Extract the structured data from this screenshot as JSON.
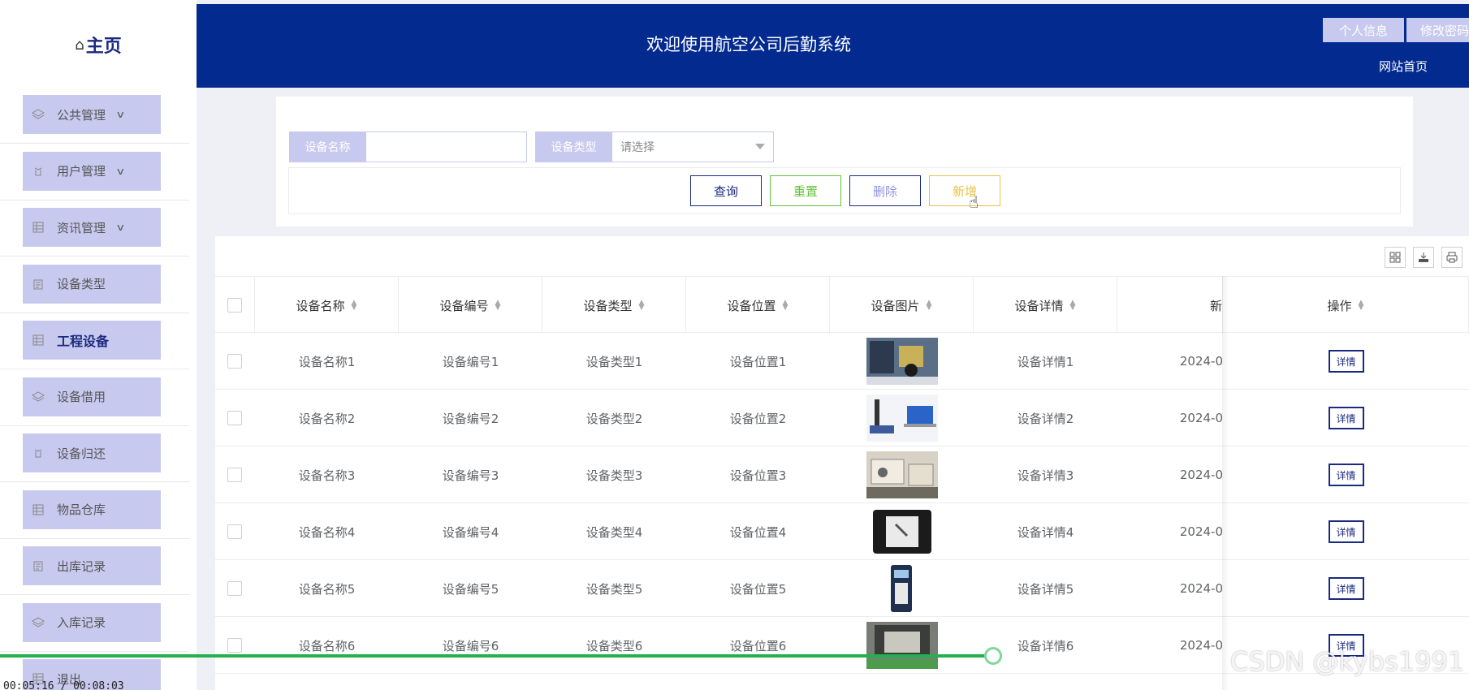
{
  "sidebar": {
    "logo": "主页",
    "items": [
      {
        "label": "公共管理",
        "icon": "layers-icon",
        "expand": true
      },
      {
        "label": "用户管理",
        "icon": "user-icon",
        "expand": true
      },
      {
        "label": "资讯管理",
        "icon": "list-icon",
        "expand": true
      },
      {
        "label": "设备类型",
        "icon": "clipboard-icon",
        "expand": false
      },
      {
        "label": "工程设备",
        "icon": "list-icon",
        "expand": false,
        "active": true
      },
      {
        "label": "设备借用",
        "icon": "layers-icon",
        "expand": false
      },
      {
        "label": "设备归还",
        "icon": "user-icon",
        "expand": false
      },
      {
        "label": "物品仓库",
        "icon": "list-icon",
        "expand": false
      },
      {
        "label": "出库记录",
        "icon": "clipboard-icon",
        "expand": false
      },
      {
        "label": "入库记录",
        "icon": "layers-icon",
        "expand": false
      },
      {
        "label": "退出",
        "icon": "list-icon",
        "expand": false
      }
    ]
  },
  "header": {
    "title": "欢迎使用航空公司后勤系统",
    "profile_btn": "个人信息",
    "password_btn": "修改密码",
    "home_link": "网站首页"
  },
  "search": {
    "name_label": "设备名称",
    "name_value": "",
    "type_label": "设备类型",
    "type_placeholder": "请选择",
    "query_btn": "查询",
    "reset_btn": "重置",
    "delete_btn": "删除",
    "add_btn": "新增"
  },
  "table": {
    "headers": [
      "设备名称",
      "设备编号",
      "设备类型",
      "设备位置",
      "设备图片",
      "设备详情",
      "新",
      "操作"
    ],
    "rows": [
      {
        "name": "设备名称1",
        "code": "设备编号1",
        "type": "设备类型1",
        "location": "设备位置1",
        "detail": "设备详情1",
        "date": "2024-0",
        "action": "详情"
      },
      {
        "name": "设备名称2",
        "code": "设备编号2",
        "type": "设备类型2",
        "location": "设备位置2",
        "detail": "设备详情2",
        "date": "2024-0",
        "action": "详情"
      },
      {
        "name": "设备名称3",
        "code": "设备编号3",
        "type": "设备类型3",
        "location": "设备位置3",
        "detail": "设备详情3",
        "date": "2024-0",
        "action": "详情"
      },
      {
        "name": "设备名称4",
        "code": "设备编号4",
        "type": "设备类型4",
        "location": "设备位置4",
        "detail": "设备详情4",
        "date": "2024-0",
        "action": "详情"
      },
      {
        "name": "设备名称5",
        "code": "设备编号5",
        "type": "设备类型5",
        "location": "设备位置5",
        "detail": "设备详情5",
        "date": "2024-0",
        "action": "详情"
      },
      {
        "name": "设备名称6",
        "code": "设备编号6",
        "type": "设备类型6",
        "location": "设备位置6",
        "detail": "设备详情6",
        "date": "2024-0",
        "action": "详情"
      }
    ]
  },
  "video": {
    "time": "00:05:16 / 00:08:03",
    "progress": 0.66
  },
  "watermark": "CSDN @kybs1991",
  "colors": {
    "header": "#032a8f",
    "menu": "#c8c9ee",
    "accent": "#1a2a80",
    "reset": "#67c23a",
    "delete": "#8f93e0",
    "add": "#e6c24a",
    "progress": "#22b14c"
  }
}
